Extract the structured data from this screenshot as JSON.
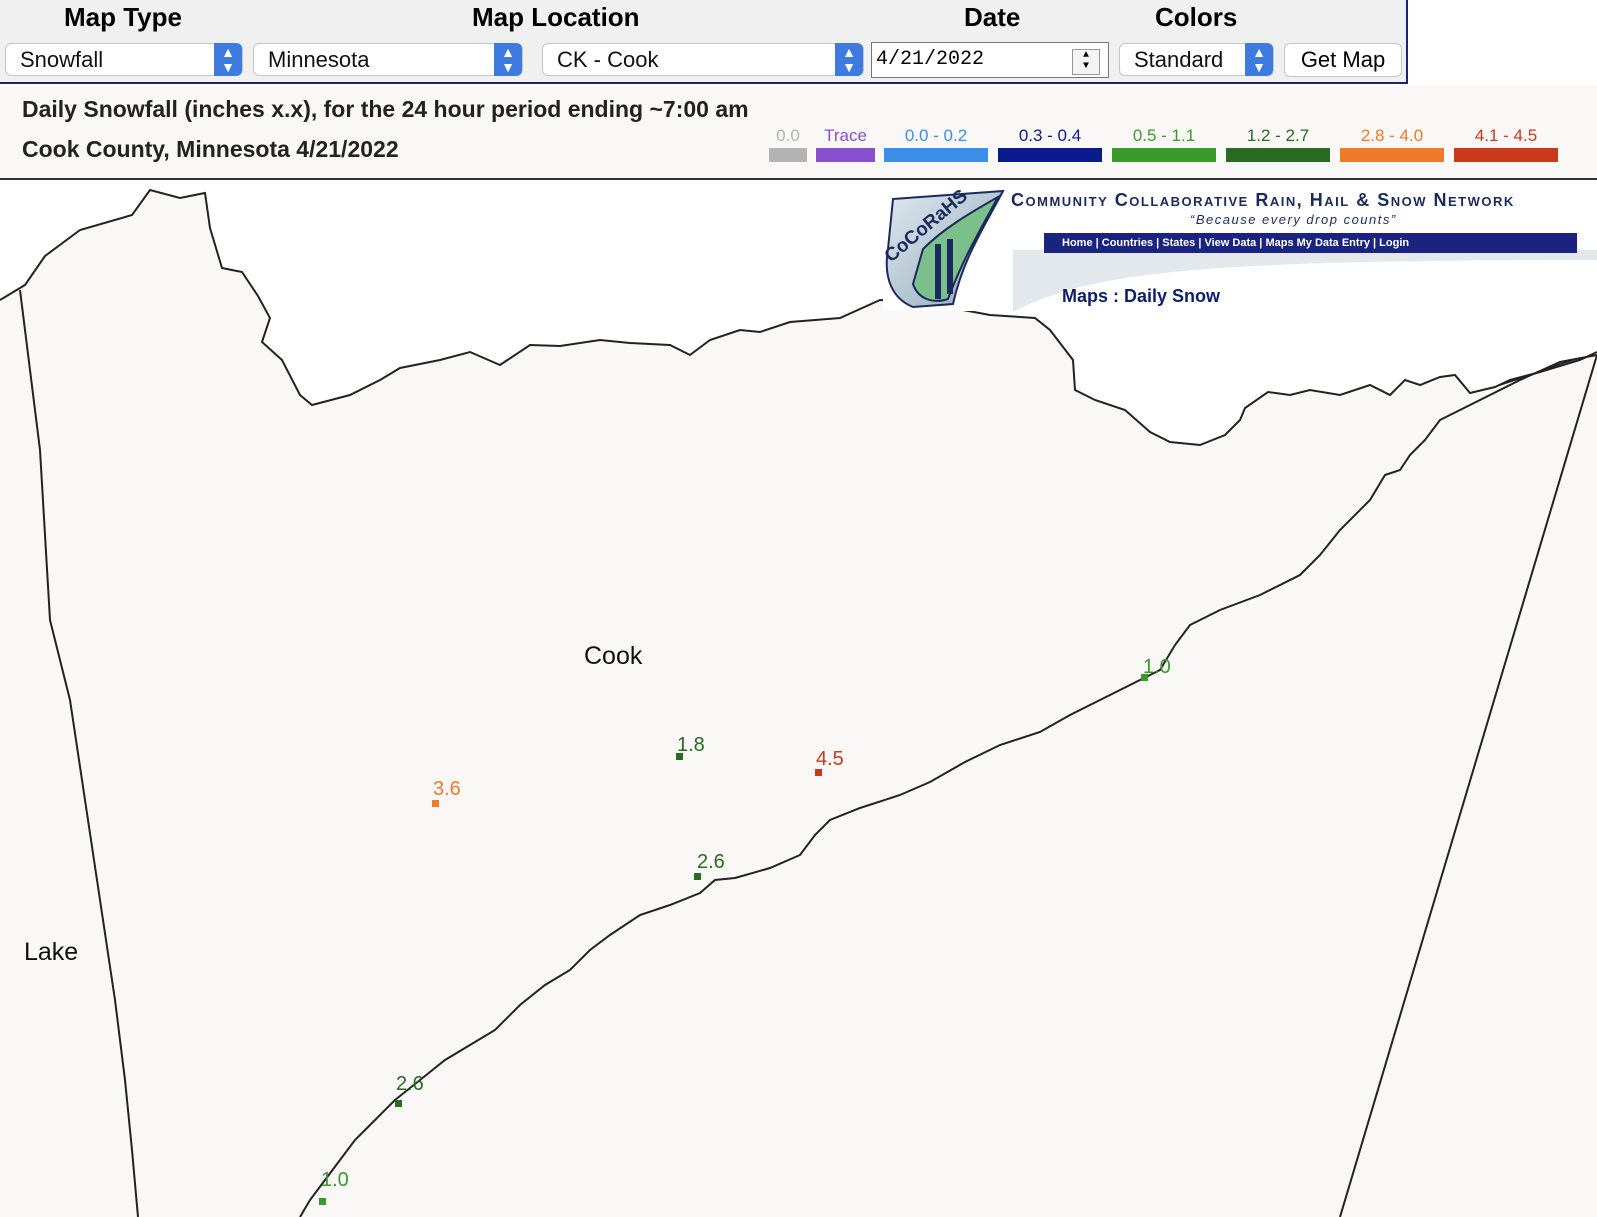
{
  "controls": {
    "map_type_label": "Map Type",
    "map_location_label": "Map Location",
    "date_label": "Date",
    "colors_label": "Colors",
    "map_type_value": "Snowfall",
    "state_value": "Minnesota",
    "county_value": "CK - Cook",
    "date_value": "4/21/2022",
    "colors_value": "Standard",
    "get_map_label": "Get Map"
  },
  "header": {
    "title_line1": "Daily Snowfall (inches  x.x),  for the 24 hour period ending ~7:00 am",
    "title_line2": "Cook County, Minnesota  4/21/2022"
  },
  "legend": [
    {
      "label": "0.0",
      "color": "#b3b3b3"
    },
    {
      "label": "Trace",
      "color": "#8a4fcf"
    },
    {
      "label": "0.0 - 0.2",
      "color": "#3b8fe8"
    },
    {
      "label": "0.3 - 0.4",
      "color": "#0a1a8c"
    },
    {
      "label": "0.5 - 1.1",
      "color": "#3a9a2a"
    },
    {
      "label": "1.2 - 2.7",
      "color": "#2a6a22"
    },
    {
      "label": "2.8 - 4.0",
      "color": "#ee7a2a"
    },
    {
      "label": "4.1 - 4.5",
      "color": "#c83a1a"
    }
  ],
  "banner": {
    "logo_mark": "CoCoRaHS",
    "network_name": "Community Collaborative Rain, Hail & Snow Network",
    "tagline": "“Because every drop counts”",
    "nav_links": "Home  |  Countries  |  States  |  View Data  |  Maps      My Data Entry  |  Login",
    "page_caption": "Maps : Daily Snow"
  },
  "map": {
    "county_labels": {
      "cook": "Cook",
      "lake": "Lake"
    },
    "observations": [
      {
        "value": "1.0",
        "color": "#3a9a2a"
      },
      {
        "value": "1.8",
        "color": "#2a6a22"
      },
      {
        "value": "4.5",
        "color": "#c83a1a"
      },
      {
        "value": "3.6",
        "color": "#ee7a2a"
      },
      {
        "value": "2.6",
        "color": "#2a6a22"
      },
      {
        "value": "2.6",
        "color": "#2a6a22"
      },
      {
        "value": "1.0",
        "color": "#3a9a2a"
      }
    ]
  }
}
